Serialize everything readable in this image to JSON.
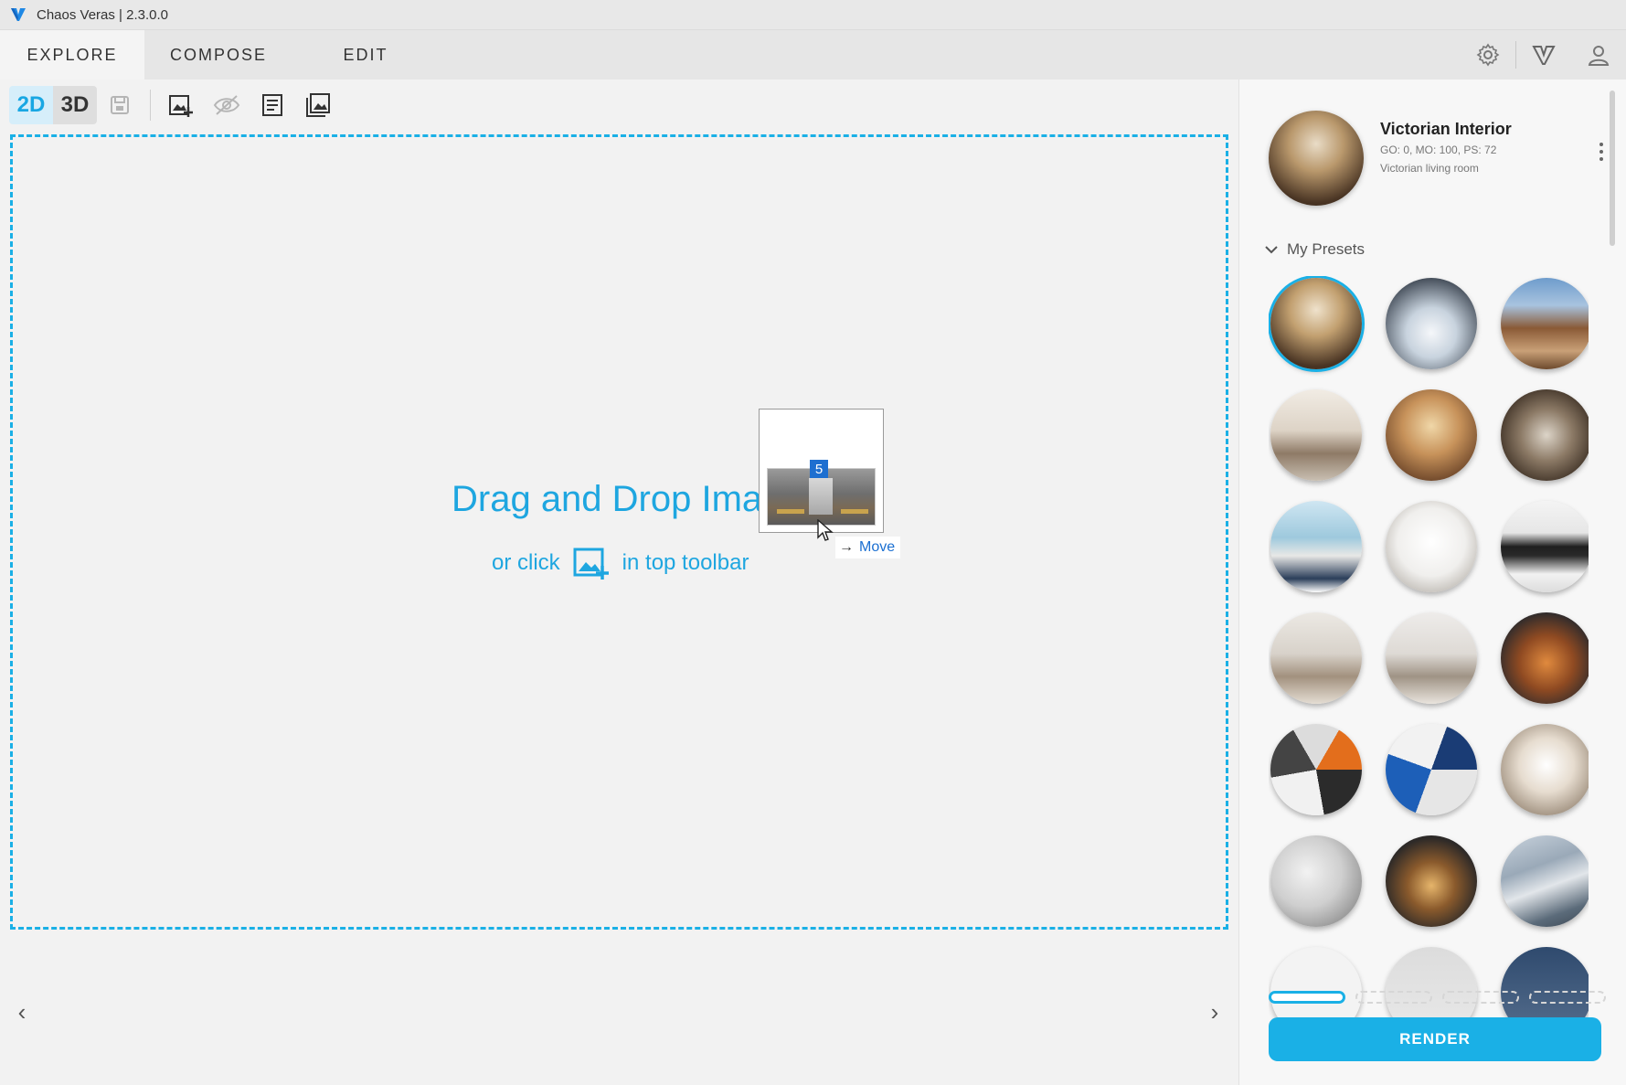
{
  "window": {
    "title": "Chaos Veras | 2.3.0.0"
  },
  "tabs": [
    {
      "label": "EXPLORE",
      "active": true
    },
    {
      "label": "COMPOSE",
      "active": false
    },
    {
      "label": "EDIT",
      "active": false
    }
  ],
  "header_icons": [
    "gear-icon",
    "veras-logo-icon",
    "user-icon"
  ],
  "toolbar": {
    "mode_2d": "2D",
    "mode_3d": "3D",
    "active_mode": "2D",
    "tools": [
      "save-icon",
      "add-image-icon",
      "hide-eye-icon",
      "notes-icon",
      "gallery-icon"
    ]
  },
  "canvas": {
    "drop_title": "Drag and Drop Imag",
    "drop_prefix": "or click",
    "drop_suffix": "in top toolbar"
  },
  "drag": {
    "badge": "5",
    "tooltip": "Move"
  },
  "preset": {
    "name": "Victorian Interior",
    "meta": "GO: 0, MO: 100, PS: 72",
    "description": "Victorian living room"
  },
  "presets_section": {
    "label": "My Presets",
    "selected_index": 0,
    "count": 21
  },
  "pager": {
    "pages": 4,
    "current": 1
  },
  "render_label": "RENDER",
  "colors": {
    "accent": "#1ab0e6",
    "tab_active_bg": "#f4f4f4",
    "canvas_bg": "#f2f2f2"
  }
}
